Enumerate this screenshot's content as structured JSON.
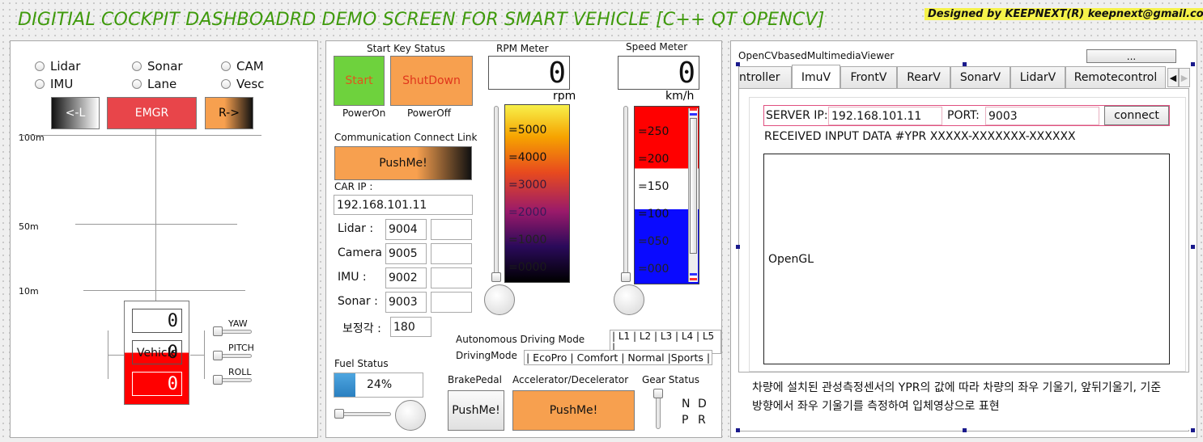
{
  "header": {
    "title": "DIGITIAL COCKPIT DASHBOADRD DEMO SCREEN FOR SMART VEHICLE [C++ QT OPENCV]",
    "designed_by": "Designed by KEEPNEXT(R) keepnext@gmail.com"
  },
  "sensors": {
    "radios": [
      "Lidar",
      "Sonar",
      "CAM",
      "IMU",
      "Lane",
      "Vesc"
    ],
    "left_button": "<-L",
    "emergency_button": "EMGR",
    "right_button": "R->",
    "distance_labels": [
      "100m",
      "50m",
      "10m"
    ],
    "vehicle_label": "Vehicle",
    "lcd_values": [
      "0",
      "0",
      "0"
    ],
    "attitude_labels": [
      "YAW",
      "PITCH",
      "ROLL"
    ]
  },
  "control": {
    "start_key_status": "Start Key Status",
    "start_button": "Start",
    "shutdown_button": "ShutDown",
    "power_on": "PowerOn",
    "power_off": "PowerOff",
    "comm_link_label": "Communication Connect Link",
    "comm_button": "PushMe!",
    "car_ip_label": "CAR IP :",
    "car_ip": "192.168.101.11",
    "ports": [
      {
        "label": "Lidar :",
        "value": "9004"
      },
      {
        "label": "Camera :",
        "value": "9005"
      },
      {
        "label": "IMU :",
        "value": "9002"
      },
      {
        "label": "Sonar :",
        "value": "9003"
      }
    ],
    "correction_label": "보정각 :",
    "correction_value": "180",
    "autonomous_label": "Autonomous Driving Mode",
    "autonomous_levels": "| L1 | L2 | L3 | L4 | L5 |",
    "driving_mode_label": "DrivingMode",
    "driving_modes": "| EcoPro | Comfort | Normal |Sports |",
    "fuel_label": "Fuel Status",
    "fuel_percent": "24%",
    "fuel_level": 0.24,
    "brake_label": "BrakePedal",
    "brake_button": "PushMe!",
    "accel_label": "Accelerator/Decelerator",
    "accel_button": "PushMe!",
    "gear_label": "Gear Status",
    "gears": [
      "N",
      "D",
      "P",
      "R"
    ]
  },
  "rpm": {
    "title": "RPM Meter",
    "value": "0",
    "unit": "rpm",
    "scale": [
      "=5000",
      "=4000",
      "=3000",
      "=2000",
      "=1000",
      "=0000"
    ]
  },
  "speed": {
    "title": "Speed Meter",
    "value": "0",
    "unit": "km/h",
    "scale": [
      "=250",
      "=200",
      "=150",
      "=100",
      "=050",
      "=000"
    ]
  },
  "viewer": {
    "title": "OpenCVbasedMultimediaViewer",
    "top_button": "...",
    "tabs": [
      "ntroller",
      "ImuV",
      "FrontV",
      "RearV",
      "SonarV",
      "LidarV",
      "Remotecontrol"
    ],
    "server_ip_label": "SERVER IP:",
    "server_ip": "192.168.101.11",
    "port_label": "PORT:",
    "port": "9003",
    "connect_button": "connect",
    "received_text": "RECEIVED INPUT DATA #YPR XXXXX-XXXXXXX-XXXXXX",
    "opengl_label": "OpenGL",
    "description_line1": "차량에 설치된 관성측정센서의 YPR의 값에 따라 차량의 좌우 기울기, 앞뒤기울기, 기준",
    "description_line2": "방향에서 좌우 기울기를 측정하여 입체영상으로 표현"
  },
  "colors": {
    "title_green": "#3f9a0c",
    "emergency_red": "#e8454a",
    "orange": "#f7a04f",
    "start_green": "#6ed23d",
    "highlight_yellow": "#f5f24a"
  }
}
